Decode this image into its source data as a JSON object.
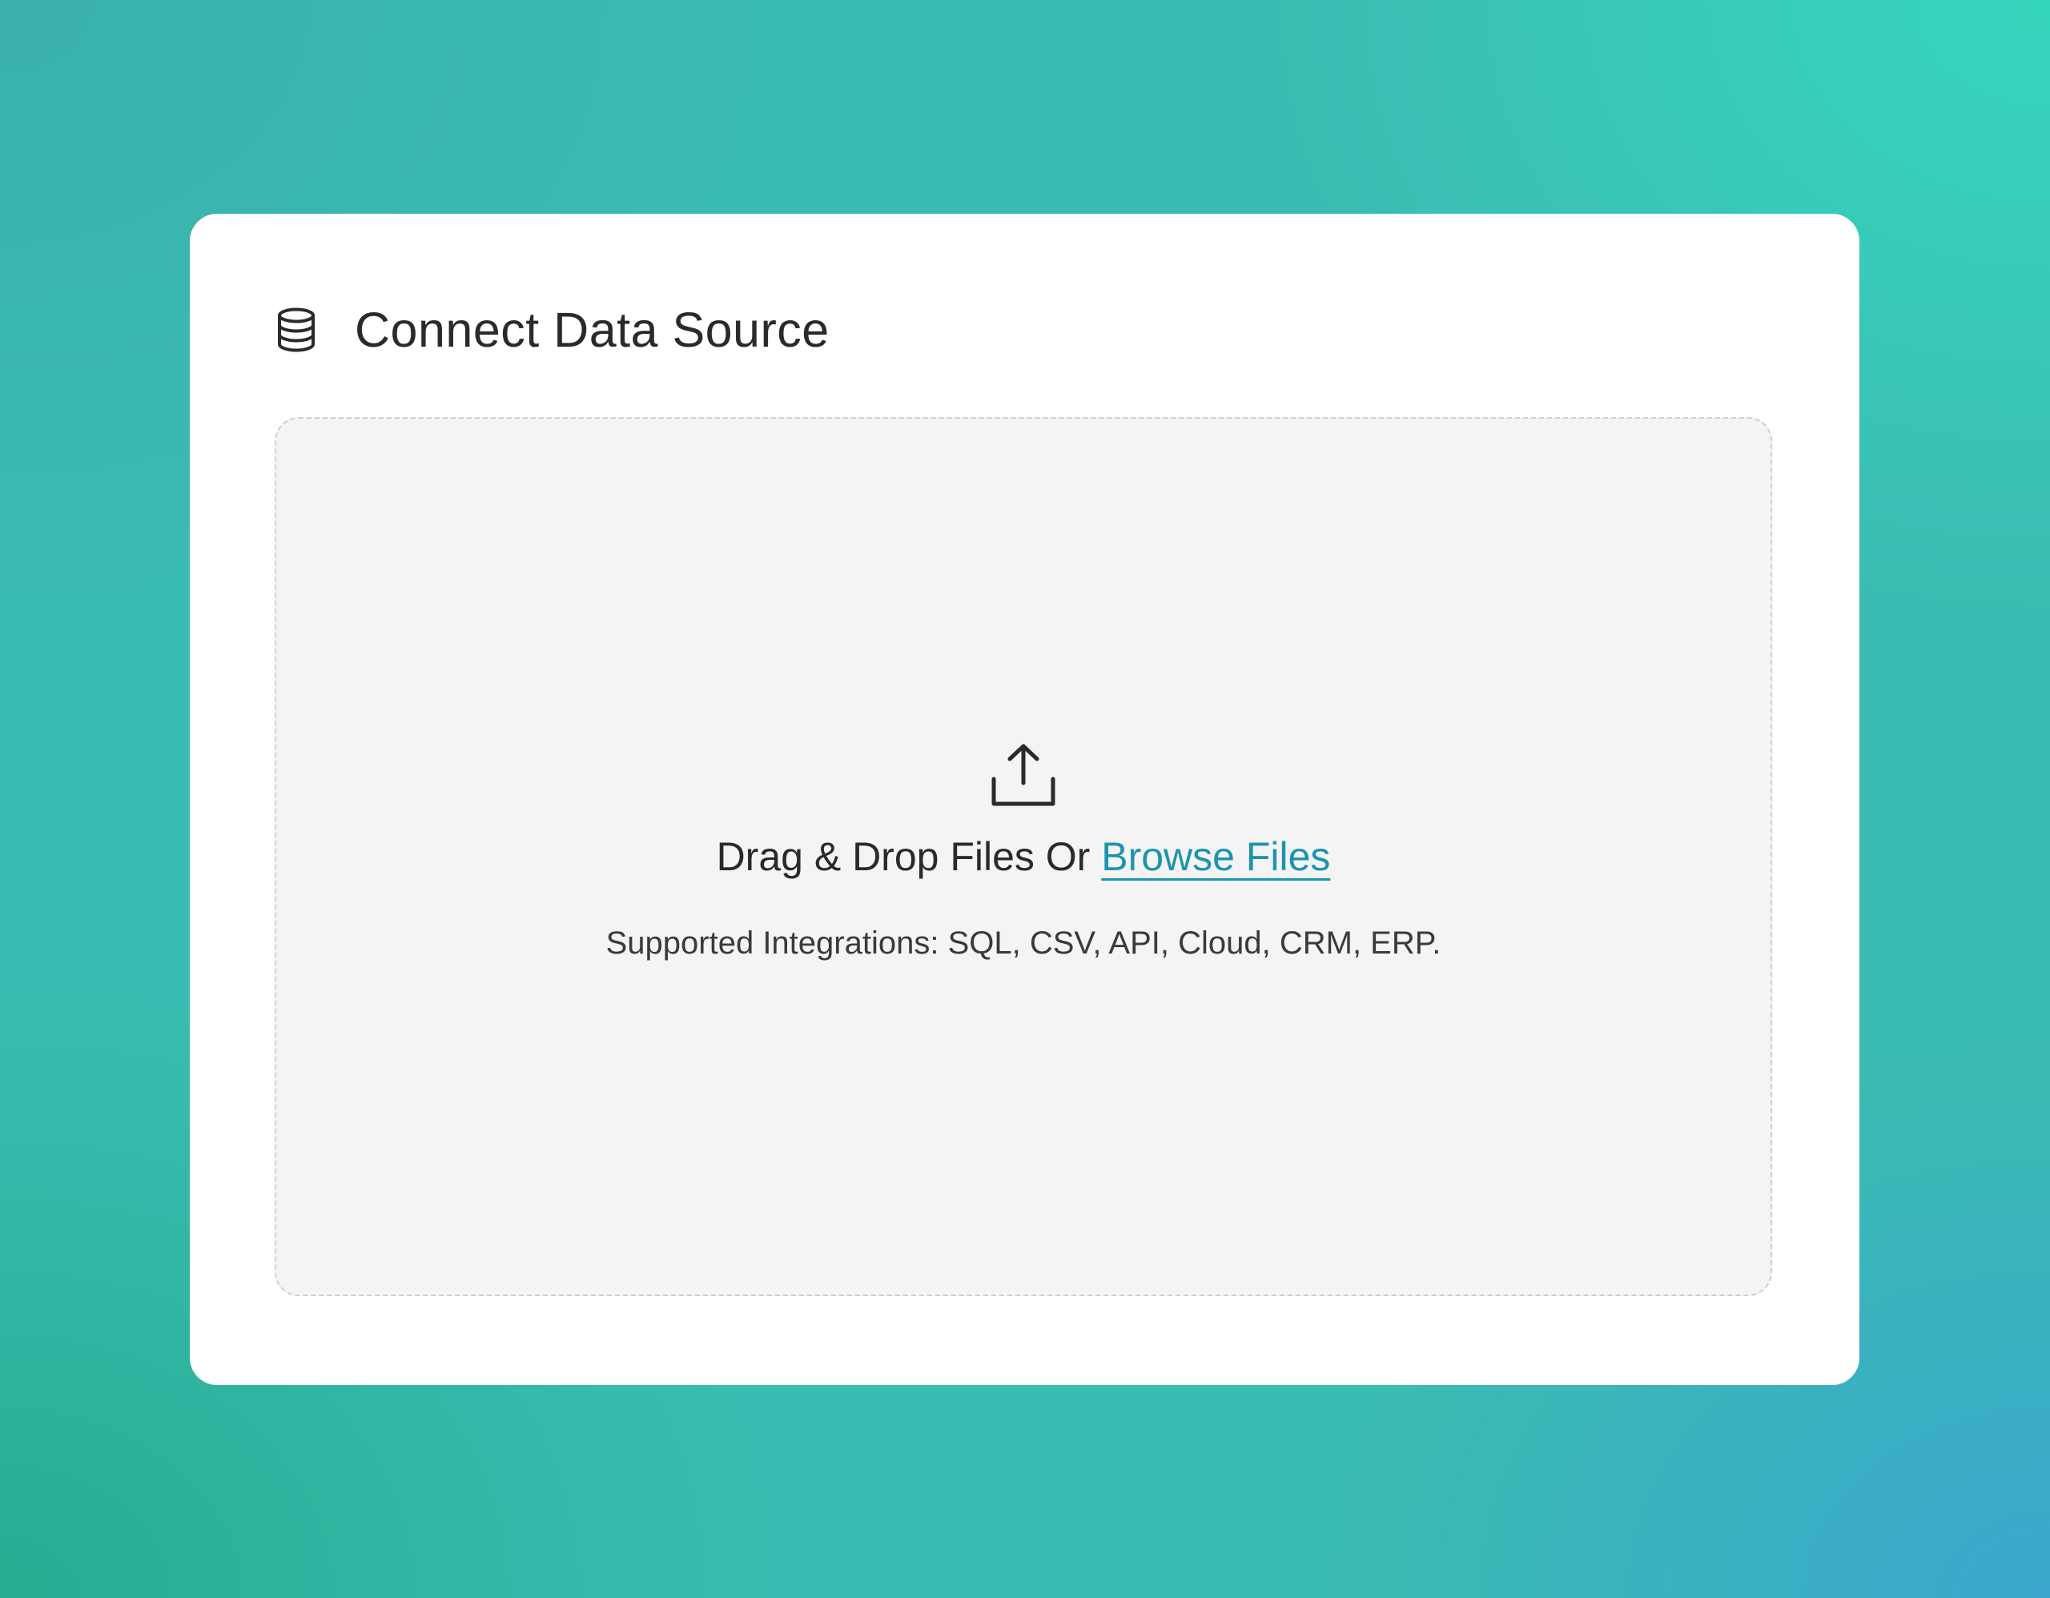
{
  "card": {
    "icon": "database-icon",
    "title": "Connect Data Source"
  },
  "dropzone": {
    "icon": "upload-icon",
    "prompt_prefix": "Drag & Drop Files Or ",
    "browse_label": "Browse Files",
    "supported_text": "Supported Integrations: SQL, CSV, API, Cloud, CRM, ERP."
  },
  "colors": {
    "link": "#1c94ad",
    "text": "#2a2a2a",
    "card_bg": "#ffffff",
    "dropzone_bg": "#f4f4f4",
    "dropzone_border": "#cfcfcf",
    "background_gradient": [
      "#3ab0ad",
      "#36d6bd",
      "#26ad93",
      "#3aa6cd"
    ]
  }
}
